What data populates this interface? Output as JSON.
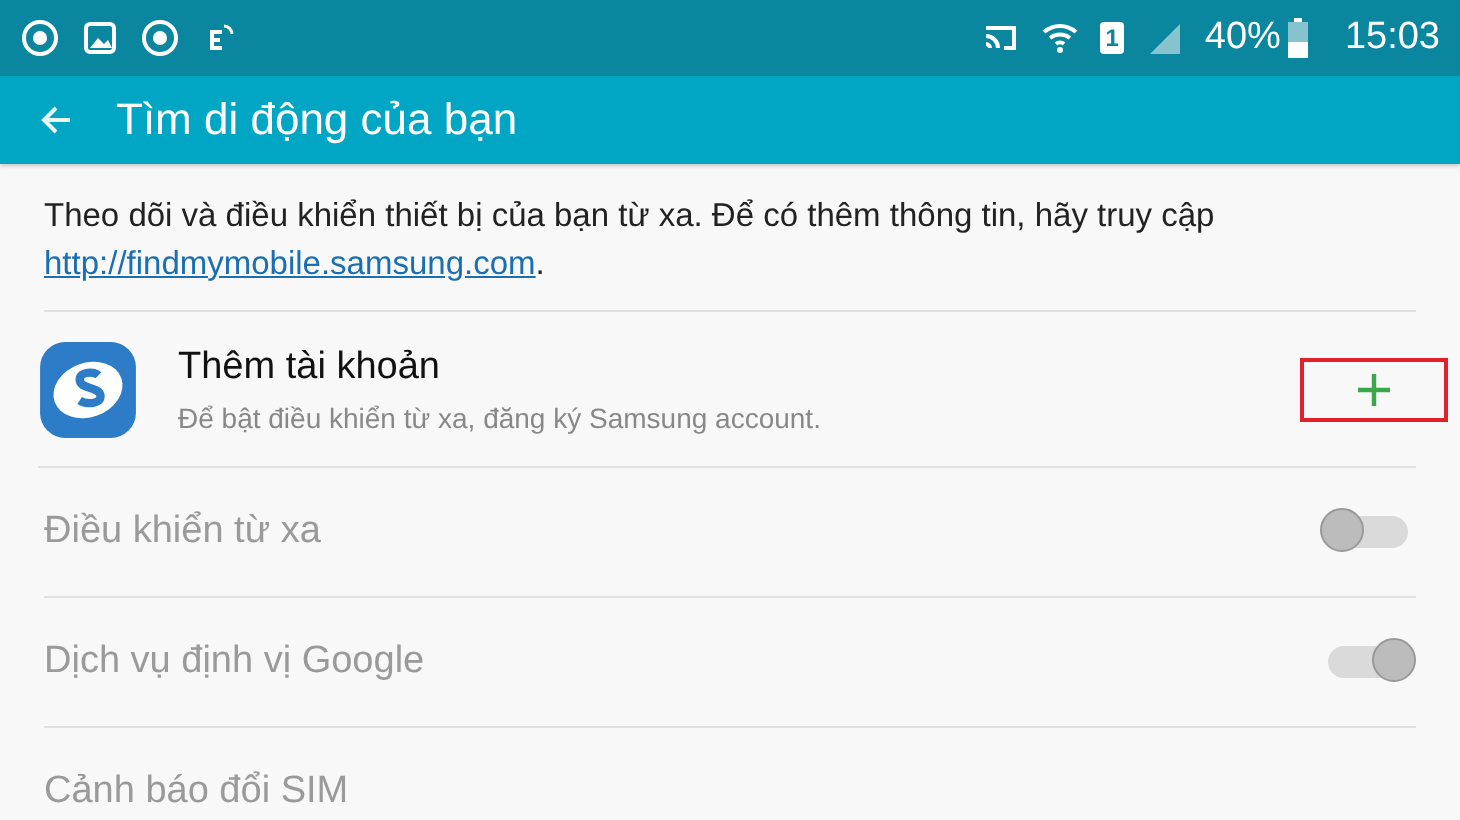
{
  "status_bar": {
    "battery": "40%",
    "time": "15:03",
    "sim": "1"
  },
  "app_bar": {
    "title": "Tìm di động của bạn"
  },
  "description": {
    "text": "Theo dõi và điều khiển thiết bị của bạn từ xa. Để có thêm thông tin, hãy truy cập",
    "link": "http://findmymobile.samsung.com",
    "after": "."
  },
  "account": {
    "title": "Thêm tài khoản",
    "subtitle": "Để bật điều khiển từ xa, đăng ký Samsung account.",
    "highlighted": true
  },
  "settings": [
    {
      "kind": "toggle",
      "label": "Điều khiển từ xa",
      "on": false,
      "disabled": true
    },
    {
      "kind": "toggle",
      "label": "Dịch vụ định vị Google",
      "on": true,
      "disabled": true
    },
    {
      "kind": "plain",
      "label": "Cảnh báo đổi SIM",
      "disabled": true
    }
  ]
}
